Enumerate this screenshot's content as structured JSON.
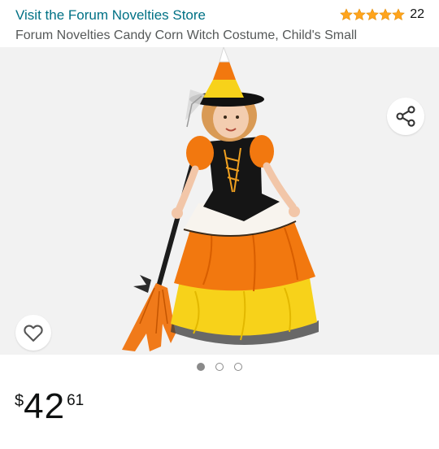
{
  "header": {
    "store_link": "Visit the Forum Novelties Store",
    "rating_count": "22",
    "rating_value": 5,
    "title": "Forum Novelties Candy Corn Witch Costume, Child's Small"
  },
  "gallery": {
    "image_count": 3,
    "active_index": 0
  },
  "price": {
    "symbol": "$",
    "whole": "42",
    "fraction": "61"
  },
  "icons": {
    "share": "share-icon",
    "wishlist": "heart-outline-icon",
    "star": "star-icon"
  },
  "colors": {
    "link": "#007185",
    "star": "#ffa41c",
    "image_background": "#f2f2f2"
  }
}
